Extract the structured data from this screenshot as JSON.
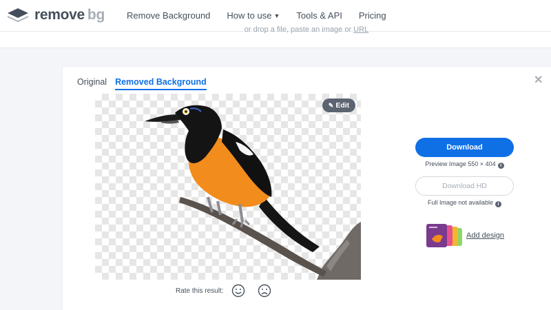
{
  "header": {
    "logo_remove": "remove",
    "logo_bg": "bg",
    "nav": [
      {
        "label": "Remove Background"
      },
      {
        "label": "How to use"
      },
      {
        "label": "Tools & API"
      },
      {
        "label": "Pricing"
      }
    ]
  },
  "dropzone": {
    "hint": "or drop a file, paste an image or",
    "url_link": "URL"
  },
  "tabs": {
    "original": "Original",
    "removed": "Removed Background"
  },
  "preview": {
    "edit_label": "Edit"
  },
  "rating": {
    "label": "Rate this result:"
  },
  "download": {
    "label": "Download",
    "preview_info": "Preview Image 550 × 404",
    "hd_label": "Download HD",
    "hd_info": "Full Image not available",
    "info_glyph": "i"
  },
  "design": {
    "label": "Add design"
  },
  "colors": {
    "accent": "#0f70e6",
    "text": "#454f5b",
    "muted": "#a6adb6"
  }
}
